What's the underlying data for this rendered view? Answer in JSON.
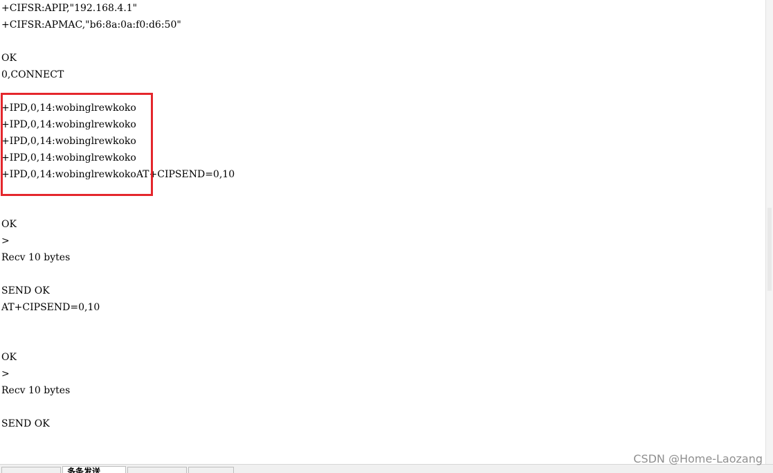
{
  "terminal": {
    "lines": [
      "+CIFSR:APIP,\"192.168.4.1\"",
      "+CIFSR:APMAC,\"b6:8a:0a:f0:d6:50\"",
      "",
      "OK",
      "0,CONNECT",
      "",
      "+IPD,0,14:wobinglrewkoko",
      "+IPD,0,14:wobinglrewkoko",
      "+IPD,0,14:wobinglrewkoko",
      "+IPD,0,14:wobinglrewkoko",
      "+IPD,0,14:wobinglrewkokoAT+CIPSEND=0,10",
      "",
      "",
      "OK",
      ">",
      "Recv 10 bytes",
      "",
      "SEND OK",
      "AT+CIPSEND=0,10",
      "",
      "",
      "OK",
      ">",
      "Recv 10 bytes",
      "",
      "SEND OK"
    ]
  },
  "highlight": {
    "color": "#e4262c"
  },
  "tabs": [
    {
      "label": "",
      "active": false
    },
    {
      "label": "多条发送",
      "active": true
    },
    {
      "label": "",
      "active": false
    },
    {
      "label": "",
      "active": false
    }
  ],
  "watermark": {
    "text": "CSDN @Home-Laozang"
  }
}
